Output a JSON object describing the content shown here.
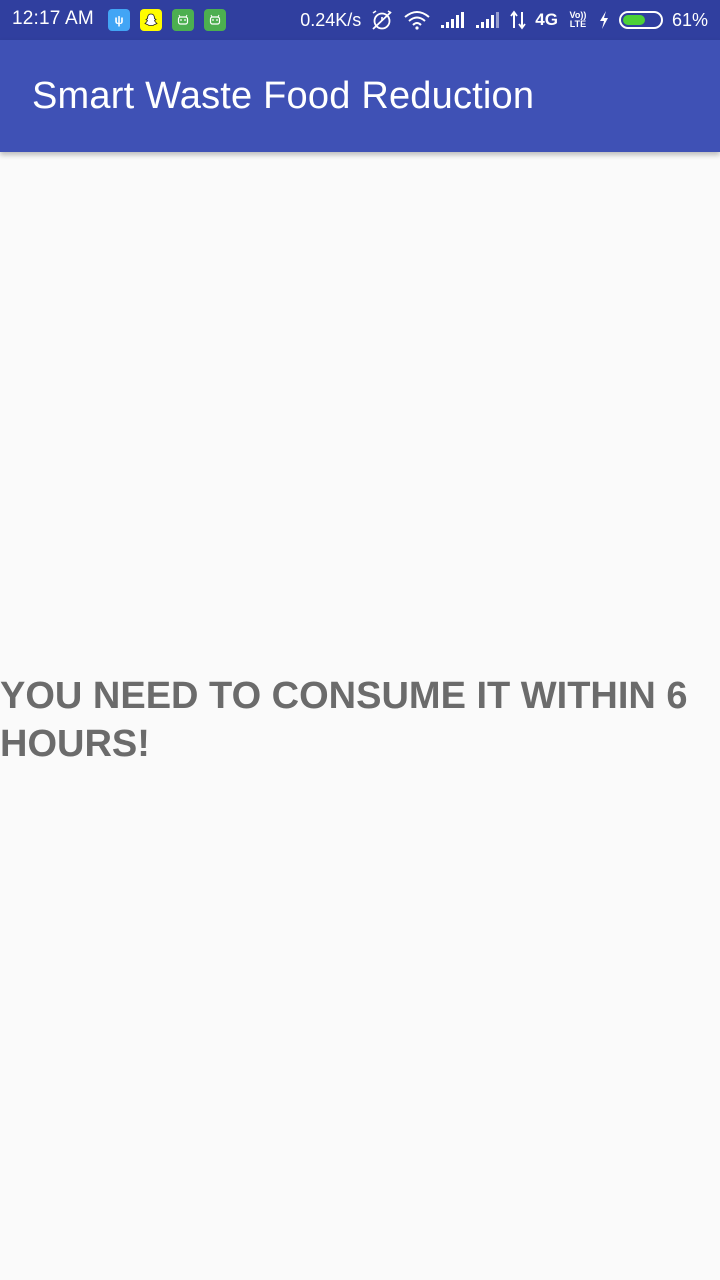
{
  "status_bar": {
    "time": "12:17 AM",
    "net_speed": "0.24K/s",
    "network_type": "4G",
    "volte_top": "Vo))",
    "volte_bottom": "LTE",
    "battery_level": 0.61,
    "battery_text": "61%",
    "notification_icons": [
      "usb-icon",
      "snapchat-icon",
      "android-icon",
      "android-icon"
    ],
    "colors": {
      "background": "#303f9f",
      "battery_fill": "#4cd137"
    }
  },
  "app_bar": {
    "title": "Smart Waste Food Reduction",
    "color": "#3f51b5"
  },
  "main": {
    "message": "YOU NEED TO CONSUME IT WITHIN 6 HOURS!",
    "message_color": "#6b6b6b"
  }
}
